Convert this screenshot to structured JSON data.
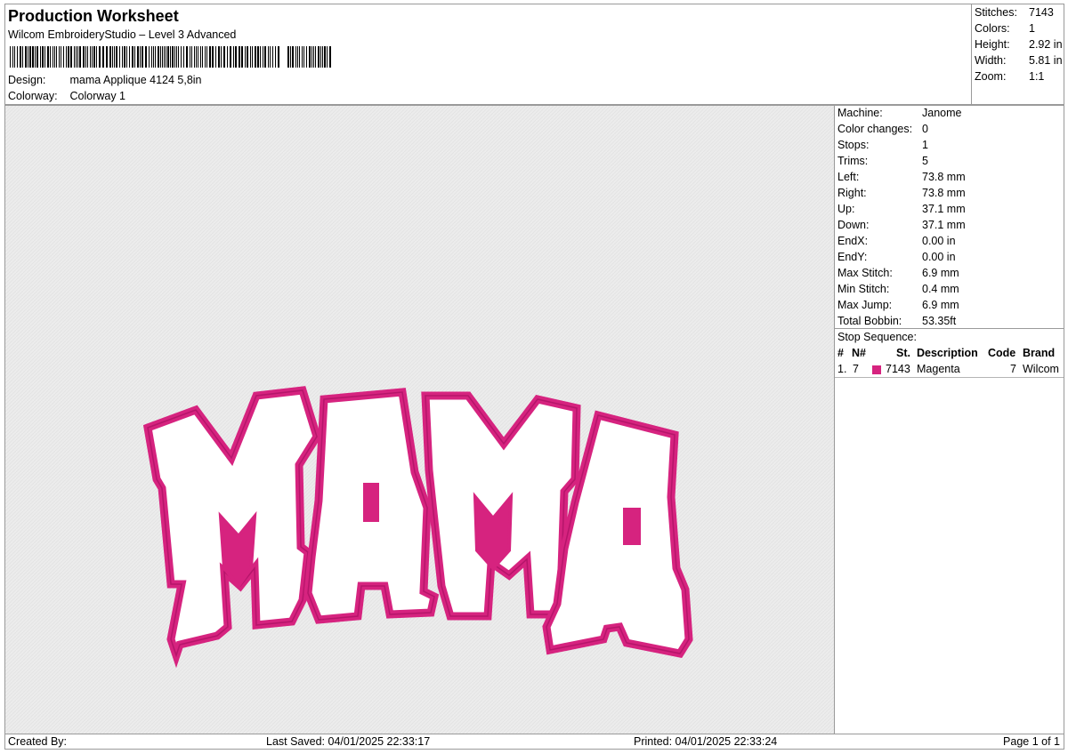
{
  "header": {
    "title": "Production Worksheet",
    "software": "Wilcom EmbroideryStudio – Level 3 Advanced",
    "design_label": "Design:",
    "design_value": "mama Applique 4124 5,8in",
    "colorway_label": "Colorway:",
    "colorway_value": "Colorway 1"
  },
  "summary": [
    {
      "key": "Stitches:",
      "value": "7143"
    },
    {
      "key": "Colors:",
      "value": "1"
    },
    {
      "key": "Height:",
      "value": "2.92 in"
    },
    {
      "key": "Width:",
      "value": "5.81 in"
    },
    {
      "key": "Zoom:",
      "value": "1:1"
    }
  ],
  "machine_info": [
    {
      "key": "Machine:",
      "value": "Janome"
    },
    {
      "key": "Color changes:",
      "value": "0"
    },
    {
      "key": "Stops:",
      "value": "1"
    },
    {
      "key": "Trims:",
      "value": "5"
    },
    {
      "key": "Left:",
      "value": "73.8 mm"
    },
    {
      "key": "Right:",
      "value": "73.8 mm"
    },
    {
      "key": "Up:",
      "value": "37.1 mm"
    },
    {
      "key": "Down:",
      "value": "37.1 mm"
    },
    {
      "key": "EndX:",
      "value": "0.00 in"
    },
    {
      "key": "EndY:",
      "value": "0.00 in"
    },
    {
      "key": "Max Stitch:",
      "value": "6.9 mm"
    },
    {
      "key": "Min Stitch:",
      "value": "0.4 mm"
    },
    {
      "key": "Max Jump:",
      "value": "6.9 mm"
    },
    {
      "key": "Total Bobbin:",
      "value": "53.35ft"
    }
  ],
  "stop_sequence": {
    "title": "Stop Sequence:",
    "columns": [
      "#",
      "N#",
      "St.",
      "Description",
      "Code",
      "Brand"
    ],
    "rows": [
      {
        "index": "1.",
        "needle": "7",
        "color": "#d6237f",
        "stitches": "7143",
        "description": "Magenta",
        "code": "7",
        "brand": "Wilcom"
      }
    ]
  },
  "design_preview": {
    "text": "MAMA",
    "thread_color": "#d6237f",
    "fill_color": "#ffffff",
    "fabric_color": "#ececec"
  },
  "footer": {
    "created_by": "Created By:",
    "last_saved": "Last Saved: 04/01/2025 22:33:17",
    "printed": "Printed: 04/01/2025 22:33:24",
    "page": "Page 1 of 1"
  }
}
